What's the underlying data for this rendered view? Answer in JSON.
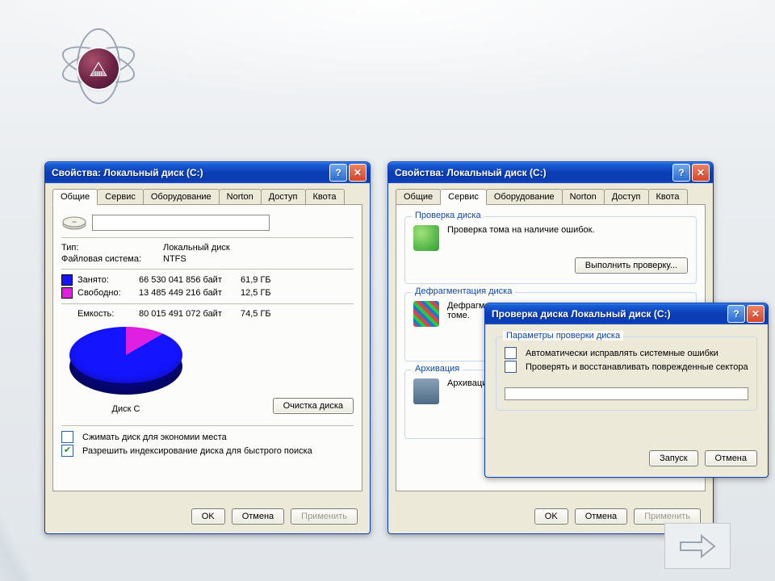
{
  "logo_alt": "УГТУ-УПИ",
  "window_title": "Свойства: Локальный диск (C:)",
  "tabs": [
    "Общие",
    "Сервис",
    "Оборудование",
    "Norton",
    "Доступ",
    "Квота"
  ],
  "general": {
    "name_value": "",
    "type_label": "Тип:",
    "type_value": "Локальный диск",
    "fs_label": "Файловая система:",
    "fs_value": "NTFS",
    "used_label": "Занято:",
    "used_bytes": "66 530 041 856 байт",
    "used_gb": "61,9 ГБ",
    "used_color": "#1414ff",
    "free_label": "Свободно:",
    "free_bytes": "13 485 449 216 байт",
    "free_gb": "12,5 ГБ",
    "free_color": "#e020e0",
    "cap_label": "Емкость:",
    "cap_bytes": "80 015 491 072 байт",
    "cap_gb": "74,5 ГБ",
    "chart_caption": "Диск C",
    "cleanup": "Очистка диска",
    "compress": "Сжимать диск для экономии места",
    "index": "Разрешить индексирование диска для быстрого поиска"
  },
  "service": {
    "check_group": "Проверка диска",
    "check_text": "Проверка тома на наличие ошибок.",
    "check_btn": "Выполнить проверку...",
    "defrag_group": "Дефрагментация диска",
    "defrag_text_a": "Дефрагмент",
    "defrag_text_b": "томе.",
    "backup_group": "Архивация",
    "backup_text": "Архивация ф"
  },
  "checkdlg": {
    "title": "Проверка диска Локальный диск (C:)",
    "group": "Параметры проверки диска",
    "opt1": "Автоматически исправлять системные ошибки",
    "opt2": "Проверять и восстанавливать поврежденные сектора",
    "start": "Запуск",
    "cancel": "Отмена"
  },
  "buttons": {
    "ok": "OK",
    "cancel": "Отмена",
    "apply": "Применить"
  },
  "chart_data": {
    "type": "pie",
    "title": "Диск C",
    "series": [
      {
        "name": "Занято",
        "value": 66530041856,
        "value_gb": 61.9,
        "color": "#1414ff"
      },
      {
        "name": "Свободно",
        "value": 13485449216,
        "value_gb": 12.5,
        "color": "#e020e0"
      }
    ],
    "total": {
      "name": "Емкость",
      "value": 80015491072,
      "value_gb": 74.5
    }
  }
}
